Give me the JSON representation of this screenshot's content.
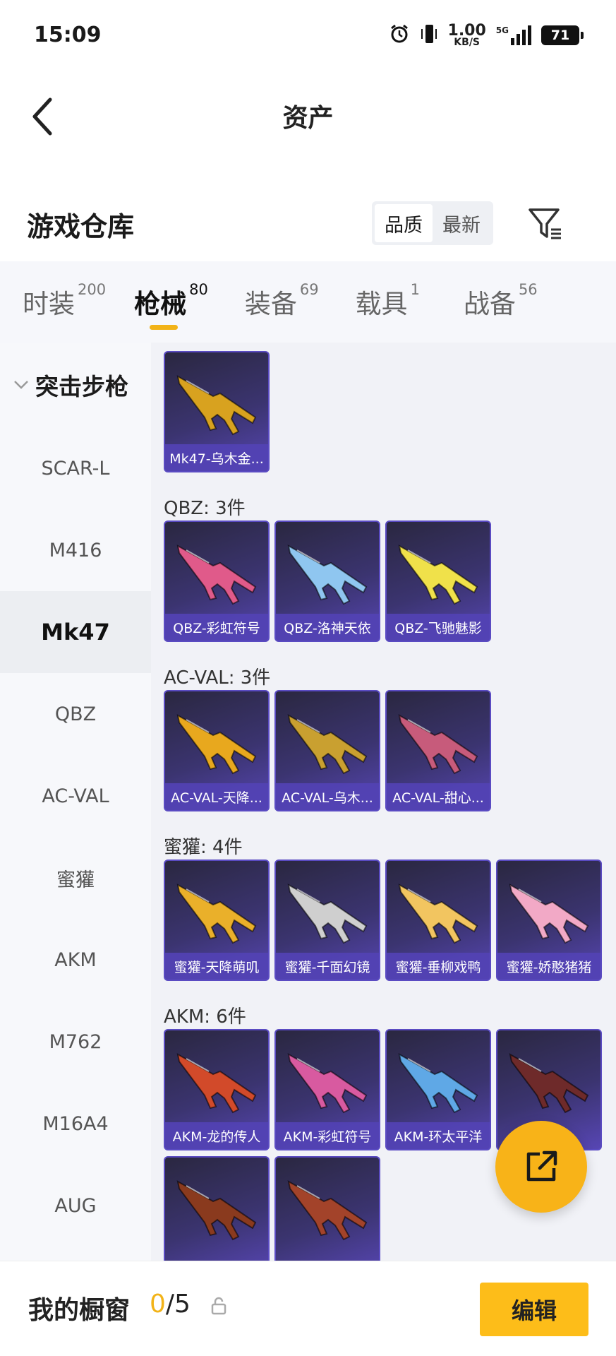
{
  "status_bar": {
    "time": "15:09",
    "net_speed": "1.00",
    "net_unit": "KB/S",
    "network": "5G",
    "battery": "71"
  },
  "nav": {
    "title": "资产"
  },
  "header": {
    "heading": "游戏仓库",
    "sort_options": [
      "品质",
      "最新"
    ],
    "active_sort": "品质"
  },
  "tabs": [
    {
      "label": "时装",
      "count": "200"
    },
    {
      "label": "枪械",
      "count": "80"
    },
    {
      "label": "装备",
      "count": "69"
    },
    {
      "label": "载具",
      "count": "1"
    },
    {
      "label": "战备",
      "count": "56"
    }
  ],
  "active_tab": "枪械",
  "sidebar": {
    "group": "突击步枪",
    "items": [
      "SCAR-L",
      "M416",
      "Mk47",
      "QBZ",
      "AC-VAL",
      "蜜獾",
      "AKM",
      "M762",
      "M16A4",
      "AUG"
    ],
    "active": "Mk47"
  },
  "sections": [
    {
      "title": "",
      "items": [
        {
          "label": "Mk47-乌木金...",
          "color": "#d8a21f"
        }
      ]
    },
    {
      "title": "QBZ: 3件",
      "items": [
        {
          "label": "QBZ-彩虹符号",
          "color": "#e05a8a"
        },
        {
          "label": "QBZ-洛神天依",
          "color": "#8fc6f0"
        },
        {
          "label": "QBZ-飞驰魅影",
          "color": "#f0e14a"
        }
      ]
    },
    {
      "title": "AC-VAL: 3件",
      "items": [
        {
          "label": "AC-VAL-天降...",
          "color": "#e8a81e"
        },
        {
          "label": "AC-VAL-乌木...",
          "color": "#c9a030"
        },
        {
          "label": "AC-VAL-甜心...",
          "color": "#c75b7b"
        }
      ]
    },
    {
      "title": "蜜獾: 4件",
      "items": [
        {
          "label": "蜜獾-天降萌叽",
          "color": "#eab02a"
        },
        {
          "label": "蜜獾-千面幻镜",
          "color": "#cfcfcf"
        },
        {
          "label": "蜜獾-垂柳戏鸭",
          "color": "#f2c560"
        },
        {
          "label": "蜜獾-娇憨猪猪",
          "color": "#f2a9c6"
        }
      ]
    },
    {
      "title": "AKM: 6件",
      "items": [
        {
          "label": "AKM-龙的传人",
          "color": "#d24a2a"
        },
        {
          "label": "AKM-彩虹符号",
          "color": "#d85aa0"
        },
        {
          "label": "AKM-环太平洋",
          "color": "#5fa8e6"
        },
        {
          "label": "",
          "color": "#6e2a2a"
        },
        {
          "label": "",
          "color": "#8a3a1e"
        },
        {
          "label": "",
          "color": "#a3432a"
        }
      ]
    }
  ],
  "bottom": {
    "label": "我的橱窗",
    "current": "0",
    "total": "/5",
    "edit_label": "编辑"
  },
  "colors": {
    "accent": "#f2b318",
    "card_bg": "#3b3470",
    "card_label_bg": "#5242b4"
  }
}
